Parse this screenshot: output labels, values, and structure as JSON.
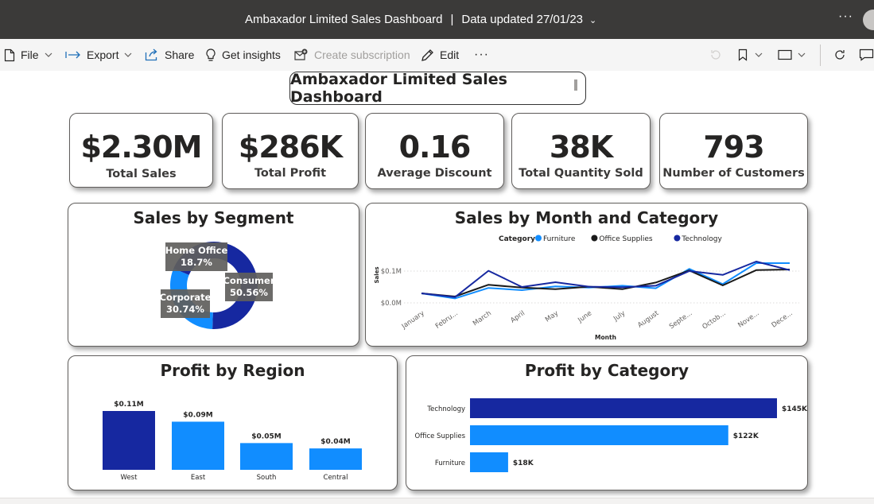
{
  "titlebar": {
    "report_name": "Ambaxador Limited Sales Dashboard",
    "separator": "|",
    "updated": "Data updated 27/01/23"
  },
  "toolbar": {
    "file": "File",
    "export": "Export",
    "share": "Share",
    "insights": "Get insights",
    "subscription": "Create subscription",
    "edit": "Edit"
  },
  "dashboard": {
    "title": "Ambaxador Limited Sales Dashboard"
  },
  "kpis": [
    {
      "value": "$2.30M",
      "label": "Total Sales"
    },
    {
      "value": "$286K",
      "label": "Total Profit"
    },
    {
      "value": "0.16",
      "label": "Average Discount"
    },
    {
      "value": "38K",
      "label": "Total Quantity Sold"
    },
    {
      "value": "793",
      "label": "Number of Customers"
    }
  ],
  "colors": {
    "dark_blue": "#1628a0",
    "blue": "#118dff",
    "black": "#1a1a1a",
    "label_bg": "#605e5c"
  },
  "chart_data": [
    {
      "type": "pie",
      "title": "Sales by Segment",
      "categories": [
        "Consumer",
        "Corporate",
        "Home Office"
      ],
      "values": [
        50.56,
        30.74,
        18.7
      ],
      "labels": [
        "50.56%",
        "30.74%",
        "18.7%"
      ]
    },
    {
      "type": "line",
      "title": "Sales by Month and Category",
      "legend_title": "Category",
      "xlabel": "Month",
      "ylabel": "Sales",
      "yticks": [
        "$0.0M",
        "$0.1M"
      ],
      "ylim": [
        0,
        0.15
      ],
      "x": [
        "January",
        "Febru...",
        "March",
        "April",
        "May",
        "June",
        "July",
        "August",
        "Septe...",
        "Octob...",
        "Nove...",
        "Dece..."
      ],
      "series": [
        {
          "name": "Furniture",
          "color": "#118dff",
          "values": [
            0.03,
            0.014,
            0.047,
            0.04,
            0.052,
            0.048,
            0.054,
            0.046,
            0.107,
            0.059,
            0.125,
            0.125
          ]
        },
        {
          "name": "Office Supplies",
          "color": "#1a1a1a",
          "values": [
            0.03,
            0.02,
            0.057,
            0.048,
            0.043,
            0.051,
            0.043,
            0.064,
            0.102,
            0.055,
            0.103,
            0.105
          ]
        },
        {
          "name": "Technology",
          "color": "#1628a0",
          "values": [
            0.03,
            0.018,
            0.101,
            0.05,
            0.065,
            0.051,
            0.049,
            0.054,
            0.1,
            0.088,
            0.13,
            0.103
          ]
        }
      ]
    },
    {
      "type": "bar",
      "title": "Profit by Region",
      "categories": [
        "West",
        "East",
        "South",
        "Central"
      ],
      "values": [
        0.11,
        0.09,
        0.05,
        0.04
      ],
      "labels": [
        "$0.11M",
        "$0.09M",
        "$0.05M",
        "$0.04M"
      ]
    },
    {
      "type": "bar",
      "orientation": "horizontal",
      "title": "Profit by Category",
      "categories": [
        "Technology",
        "Office Supplies",
        "Furniture"
      ],
      "values": [
        145,
        122,
        18
      ],
      "labels": [
        "$145K",
        "$122K",
        "$18K"
      ]
    }
  ]
}
